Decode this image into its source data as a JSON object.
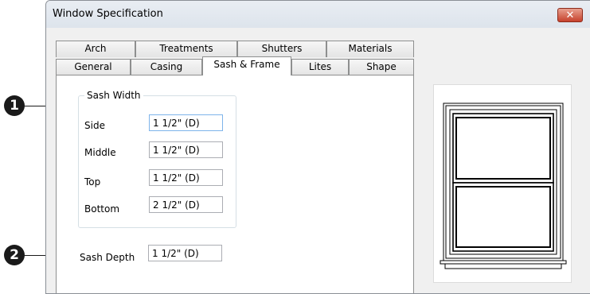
{
  "window": {
    "title": "Window Specification",
    "close_glyph": "✕"
  },
  "tabs_back": [
    "Arch",
    "Treatments",
    "Shutters",
    "Materials"
  ],
  "tabs_front": [
    "General",
    "Casing",
    "Sash & Frame",
    "Lites",
    "Shape"
  ],
  "active_tab": "Sash & Frame",
  "sash_width": {
    "group_label": "Sash Width",
    "side_label": "Side",
    "side_value": "1 1/2\" (D)",
    "middle_label": "Middle",
    "middle_value": "1 1/2\" (D)",
    "top_label": "Top",
    "top_value": "1 1/2\" (D)",
    "bottom_label": "Bottom",
    "bottom_value": "2 1/2\" (D)"
  },
  "sash_depth": {
    "label": "Sash Depth",
    "value": "1 1/2\" (D)"
  },
  "callouts": [
    "1",
    "2"
  ],
  "colors": {
    "close_button": "#c6412c",
    "focus_border": "#7eb4ea",
    "callout": "#1a1a1a"
  }
}
